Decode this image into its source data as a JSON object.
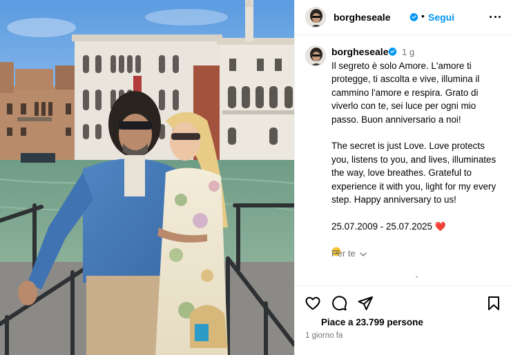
{
  "post": {
    "username": "borgheseale",
    "follow_label": "Segui",
    "caption_time": "1 g",
    "caption_lines": [
      "Il segreto è solo Amore. L'amore ti",
      "protegge, ti ascolta e vive, illumina il",
      "cammino l'amore e respira. Grato di",
      "viverlo con te, sei luce per ogni mio",
      "passo. Buon anniversario a noi!"
    ],
    "caption_en_lines": [
      "The secret is just Love. Love protects",
      "you, listens to you, and lives, illuminates",
      "the way, love breathes. Grateful to",
      "experience it with you, light for my every",
      "step. Happy anniversary to us!"
    ],
    "dates": "25.07.2009 - 25.07.2025",
    "heart_glyph": "❤️",
    "per_te_label": "Per te",
    "likes_label": "Piace a 23.799 persone",
    "posted_time": "1 giorno fa"
  },
  "icons": {
    "verified": "verified-badge-icon",
    "more": "more-options-icon",
    "like": "heart-outline-icon",
    "comment": "comment-bubble-icon",
    "share": "paper-plane-icon",
    "save": "bookmark-icon",
    "chevron": "chevron-down-icon",
    "emoji": "smirk-face-emoji"
  },
  "colors": {
    "accent": "#0095f6",
    "verified": "#0095f6",
    "secondary_text": "#737373",
    "divider": "#efefef",
    "heart": "#e0245e"
  }
}
